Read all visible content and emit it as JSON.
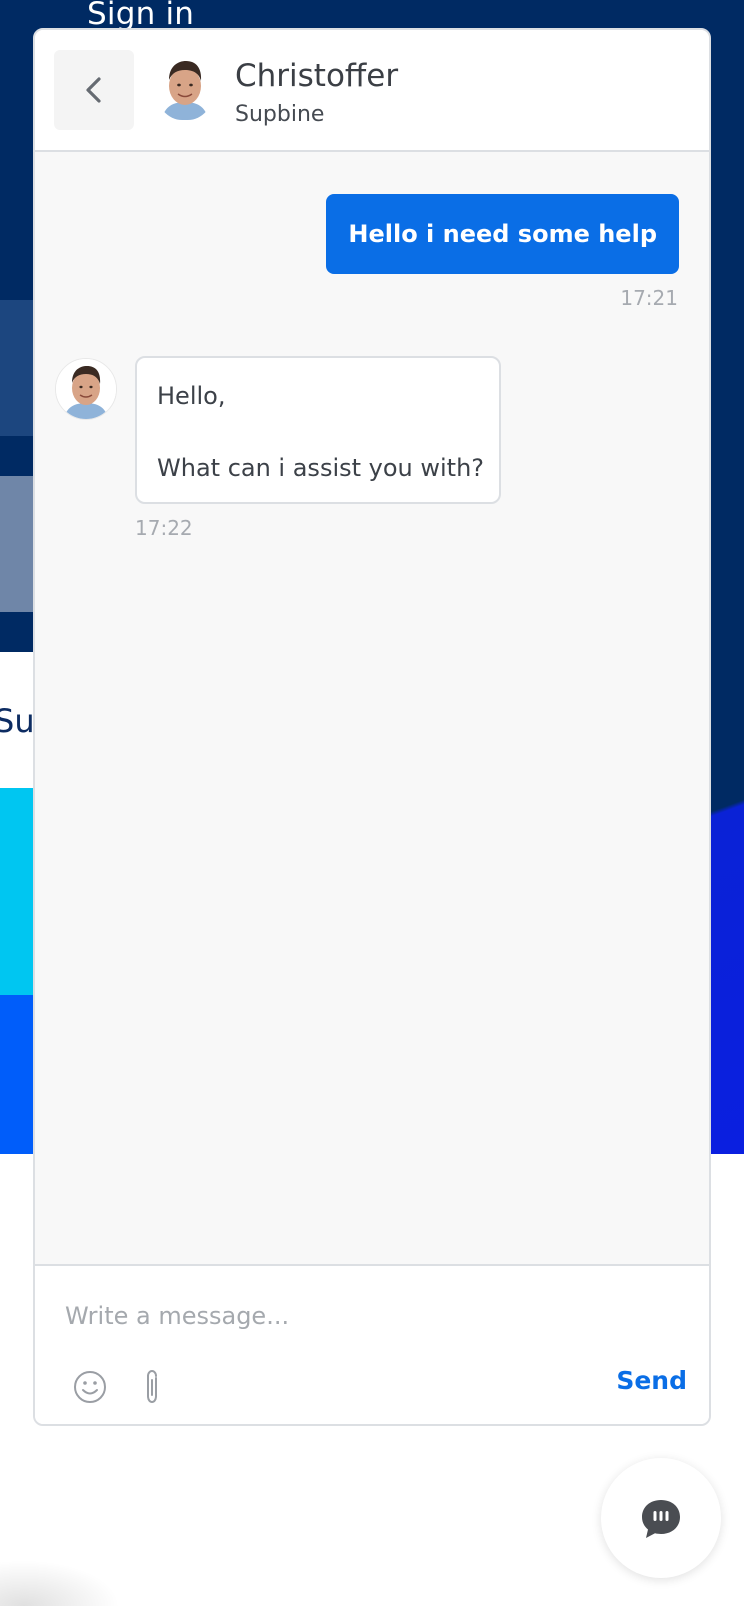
{
  "background": {
    "signin_text": "Sign in",
    "partial_text": "Su"
  },
  "chat": {
    "header": {
      "back_icon": "chevron-left-icon",
      "agent_name": "Christoffer",
      "agent_company": "Supbine"
    },
    "messages": [
      {
        "direction": "outgoing",
        "lines": [
          "Hello i need some help"
        ],
        "time": "17:21"
      },
      {
        "direction": "incoming",
        "lines": [
          "Hello,",
          "",
          "What can i assist you with?"
        ],
        "time": "17:22"
      }
    ],
    "composer": {
      "placeholder": "Write a message...",
      "emoji_icon": "smiley-icon",
      "attach_icon": "paperclip-icon",
      "send_label": "Send"
    },
    "launcher_icon": "chat-bubble-icon",
    "colors": {
      "accent": "#0a6ee6",
      "background_dark": "#002a63"
    }
  }
}
